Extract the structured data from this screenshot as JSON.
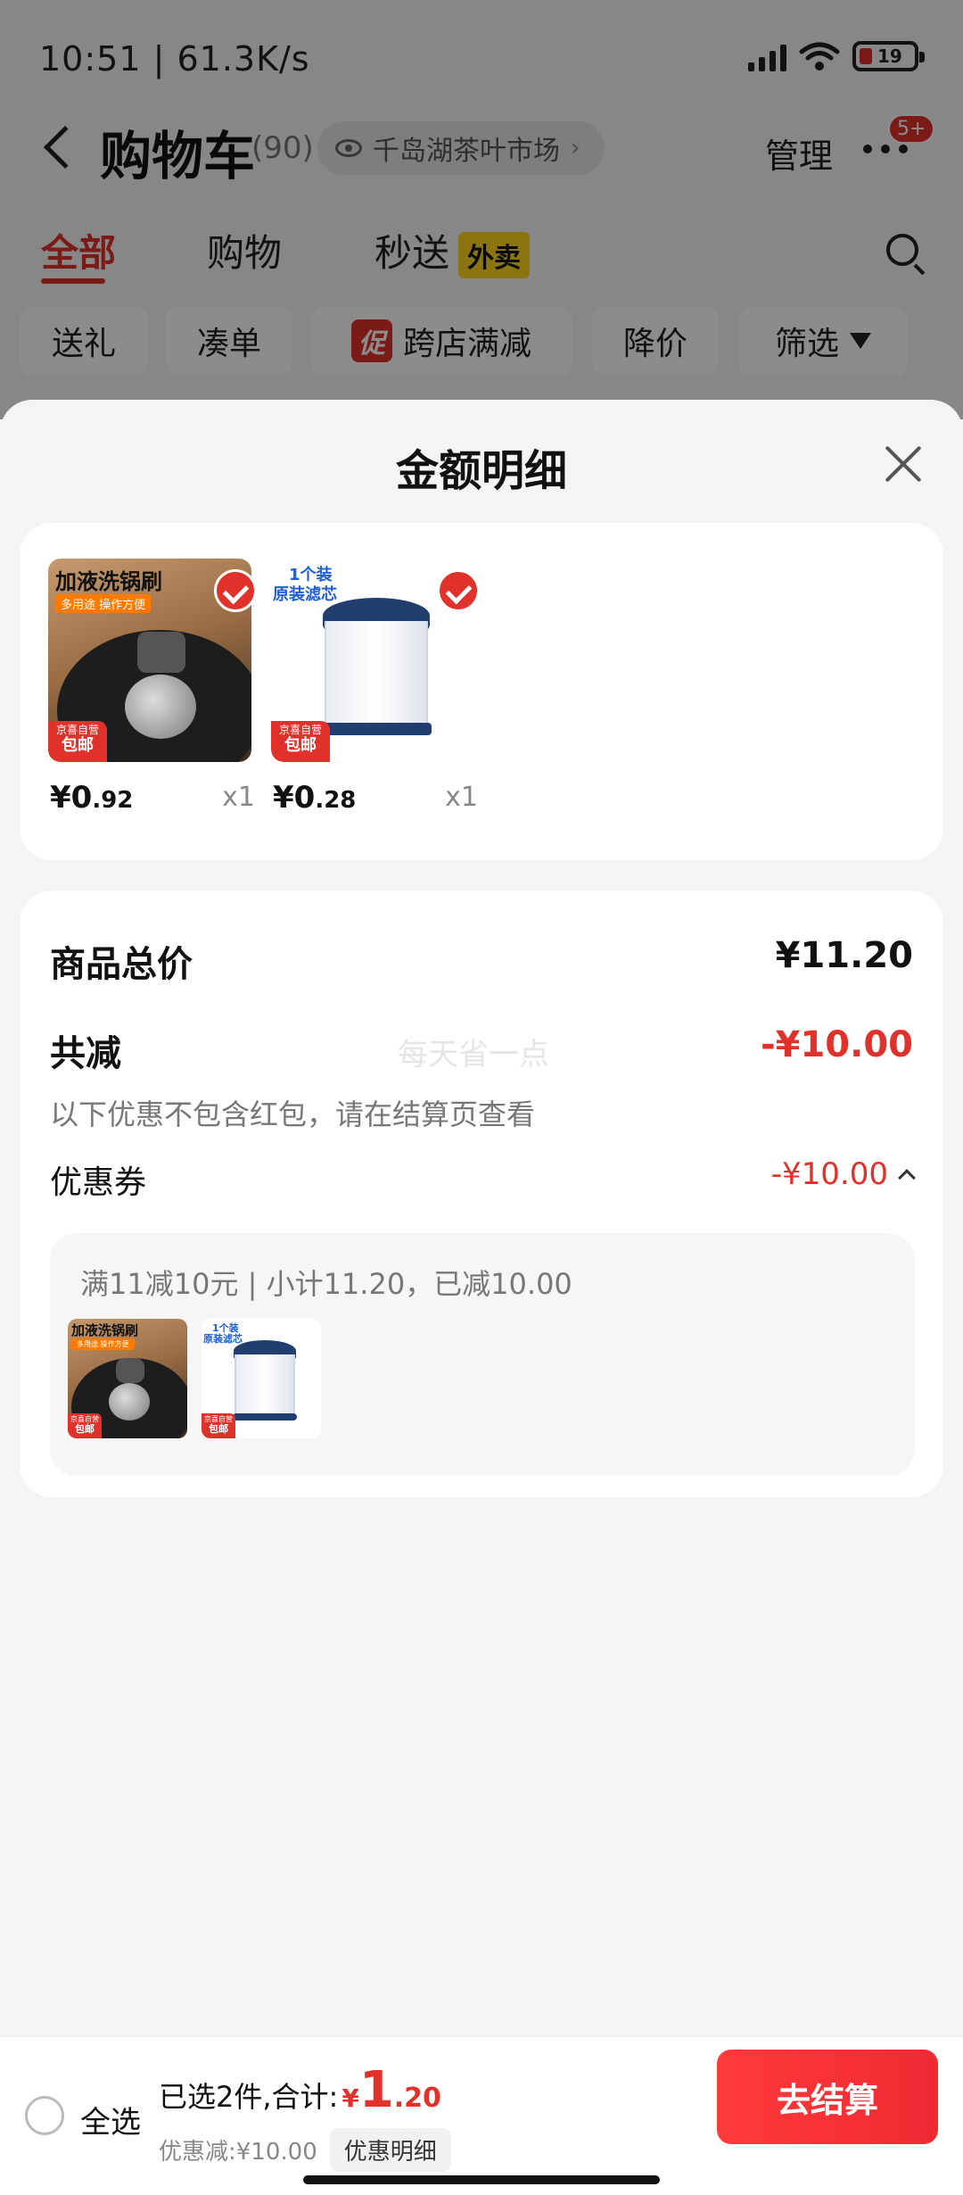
{
  "status_bar": {
    "time": "10:51 | 61.3K/s",
    "battery": "19"
  },
  "cart_header": {
    "title": "购物车",
    "count": "(90)",
    "store": "千岛湖茶叶市场",
    "manage": "管理",
    "more_badge": "5+"
  },
  "tabs": [
    {
      "label": "全部"
    },
    {
      "label": "购物"
    },
    {
      "label": "秒送"
    }
  ],
  "waimai_tag": "外卖",
  "chips": [
    "送礼",
    "凑单",
    "跨店满减",
    "降价",
    "筛选"
  ],
  "promo_badge": "促",
  "sheet": {
    "title": "金额明细"
  },
  "products": [
    {
      "thumb_title": "加液洗锅刷",
      "thumb_sub": "多用途 操作方便",
      "ship_top": "京喜自营",
      "ship_bottom": "包邮",
      "price_int": "¥0",
      "price_dec": ".92",
      "qty": "x1"
    },
    {
      "thumb_line1": "1个装",
      "thumb_line2": "原装滤芯",
      "ship_top": "京喜自营",
      "ship_bottom": "包邮",
      "price_int": "¥0",
      "price_dec": ".28",
      "qty": "x1"
    }
  ],
  "summary": {
    "total_label": "商品总价",
    "total_value": "¥11.20",
    "discount_label": "共减",
    "discount_value": "-¥10.00",
    "note": "以下优惠不包含红包，请在结算页查看",
    "watermark": "每天省一点",
    "coupon_label": "优惠券",
    "coupon_value": "-¥10.00",
    "coupon_rule": "满11减10元 | 小计11.20，已减10.00"
  },
  "bottom_bar": {
    "select_all": "全选",
    "selected_text": "已选2件,合计:",
    "currency": "¥",
    "total_int": "1",
    "total_dec": ".20",
    "discount_text": "优惠减:¥10.00",
    "detail_button": "优惠明细",
    "checkout": "去结算"
  },
  "colors": {
    "accent": "#e0322b",
    "waimai": "#ffd51e"
  }
}
